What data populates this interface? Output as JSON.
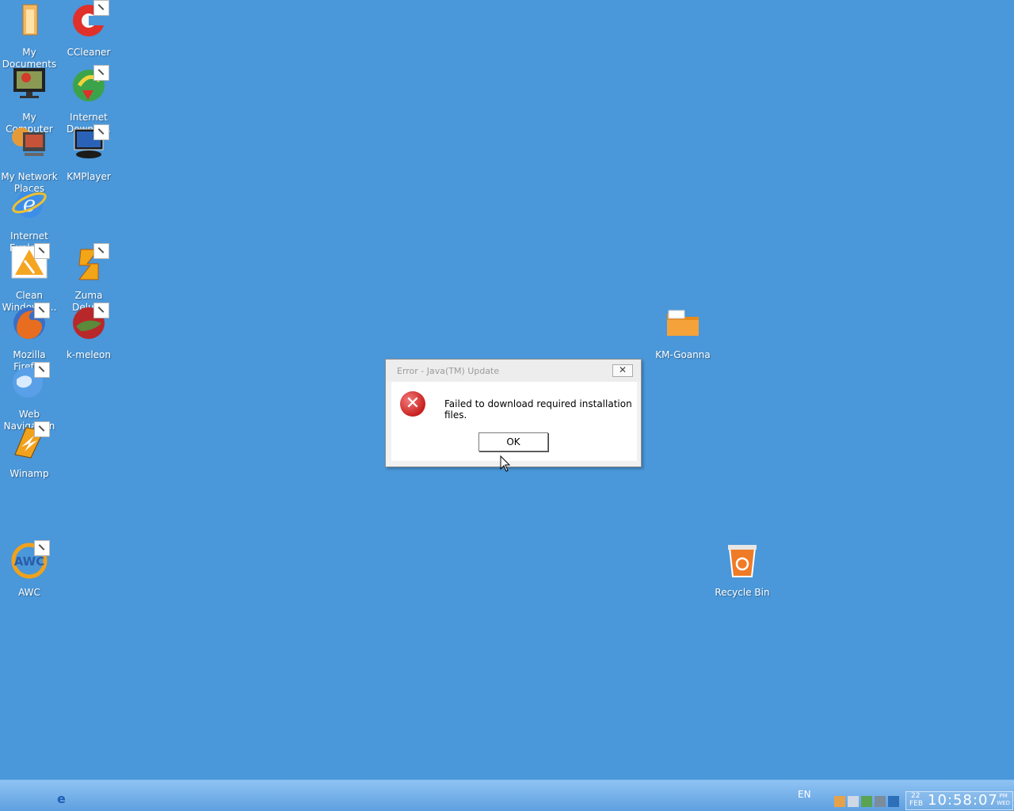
{
  "desktop": {
    "icons": [
      {
        "label": "My Documents",
        "icon": "folder-documents-icon"
      },
      {
        "label": "CCleaner",
        "icon": "ccleaner-icon"
      },
      {
        "label": "My Computer",
        "icon": "computer-icon"
      },
      {
        "label": "Internet Downlo...",
        "icon": "download-manager-icon"
      },
      {
        "label": "My Network Places",
        "icon": "network-icon"
      },
      {
        "label": "KMPlayer",
        "icon": "kmplayer-icon"
      },
      {
        "label": "Internet Explorer",
        "icon": "ie-icon"
      },
      {
        "label": "Clean Windows ...",
        "icon": "clean-windows-icon"
      },
      {
        "label": "Zuma Deluxe",
        "icon": "zuma-icon"
      },
      {
        "label": "Mozilla Firefox",
        "icon": "firefox-icon"
      },
      {
        "label": "k-meleon",
        "icon": "kmeleon-icon"
      },
      {
        "label": "Web Navigation",
        "icon": "web-navigation-icon"
      },
      {
        "label": "Winamp",
        "icon": "winamp-icon"
      },
      {
        "label": "AWC",
        "icon": "awc-icon"
      },
      {
        "label": "KM-Goanna",
        "icon": "folder-icon"
      },
      {
        "label": "Recycle Bin",
        "icon": "recycle-bin-icon"
      }
    ]
  },
  "dialog": {
    "title": "Error - Java(TM) Update",
    "close_glyph": "✕",
    "error_glyph": "✕",
    "message": "Failed to download required installation files.",
    "ok_label": "OK"
  },
  "taskbar": {
    "quicklaunch_ie_glyph": "e",
    "language": "EN",
    "date_day": "22",
    "date_month": "FEB",
    "time": "10:58:07",
    "ampm_top": "PM",
    "ampm_bottom": "WED"
  },
  "colors": {
    "desktop_bg": "#4a97d9",
    "error_red": "#c91f1f",
    "folder_orange": "#f5a23a"
  }
}
